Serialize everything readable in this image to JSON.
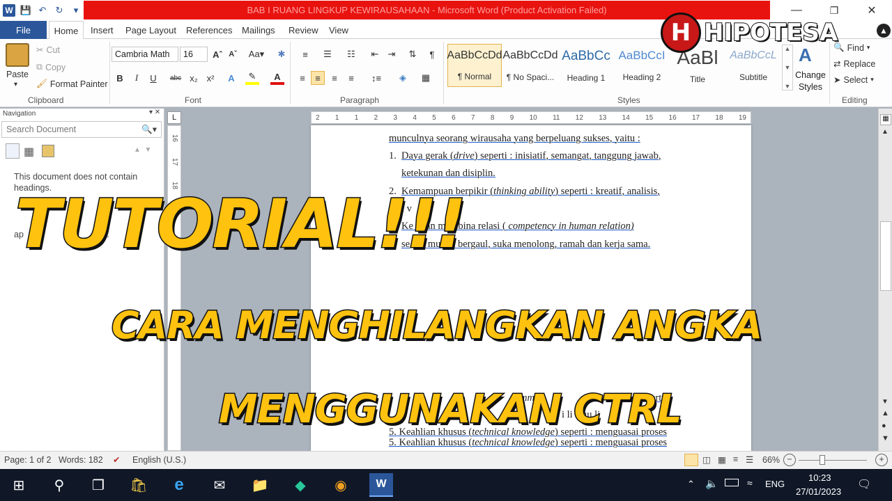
{
  "window": {
    "title": "BAB I RUANG LINGKUP KEWIRAUSAHAAN  -  Microsoft Word (Product Activation Failed)",
    "controls": [
      "—",
      "❐",
      "✕"
    ]
  },
  "tabs": [
    "File",
    "Home",
    "Insert",
    "Page Layout",
    "References",
    "Mailings",
    "Review",
    "View"
  ],
  "clipboard": {
    "paste": "Paste",
    "cut": "Cut",
    "copy": "Copy",
    "format_painter": "Format Painter",
    "group": "Clipboard"
  },
  "font": {
    "name": "Cambria Math",
    "size": "16",
    "group": "Font"
  },
  "paragraph": {
    "group": "Paragraph"
  },
  "styles": {
    "group": "Styles",
    "items": [
      {
        "preview": "AaBbCcDd",
        "name": "¶ Normal"
      },
      {
        "preview": "AaBbCcDd",
        "name": "¶ No Spaci..."
      },
      {
        "preview": "AaBbCc",
        "name": "Heading 1"
      },
      {
        "preview": "AaBbCcI",
        "name": "Heading 2"
      },
      {
        "preview": "AaBl",
        "name": "Title"
      },
      {
        "preview": "AaBbCcL",
        "name": "Subtitle"
      }
    ],
    "change": "Change Styles"
  },
  "editing": {
    "find": "Find",
    "replace": "Replace",
    "select": "Select",
    "group": "Editing"
  },
  "navigation": {
    "title": "Navigation",
    "search_placeholder": "Search Document",
    "no_headings": "This document does not contain headings.",
    "hint_fragment": "ap",
    "hint_end": "es."
  },
  "ruler": [
    "2",
    "1",
    "1",
    "2",
    "3",
    "4",
    "5",
    "6",
    "7",
    "8",
    "9",
    "10",
    "11",
    "12",
    "13",
    "14",
    "15",
    "16",
    "17",
    "18",
    "19"
  ],
  "vruler": [
    "16",
    "17",
    "18",
    "19"
  ],
  "document": {
    "line0": "munculnya seorang wirausaha yang berpeluang sukses, yaitu :",
    "item1_num": "1.",
    "item1_a": "Daya gerak (",
    "item1_b": "drive",
    "item1_c": ") seperti : inisiatif, semangat, tanggung jawab,",
    "item1_line2": "ketekunan dan disiplin.",
    "item2_num": "2.",
    "item2_a": "Kemampuan berpikir (",
    "item2_b": "thinking ability",
    "item2_c": ") seperti : kreatif, analisis,",
    "item2_line2": "i  v",
    "item3_a": "Ke   puan membina relasi ( ",
    "item3_b": "competency",
    "item3_c": " in human relation)",
    "item3_line2a": "se",
    "item3_line2b": ": mudah bergaul, suka menolong, ramah dan kerja sama.",
    "item4_end": "erti :",
    "item4_mid": "mm",
    "item4_line2": "i li    atau   li",
    "item5_a": "5.  Keahlian khusus (",
    "item5_b": "technical knowledge",
    "item5_c": ") seperti : menguasai proses"
  },
  "overlay": {
    "line1": "TUTORIAL!!!",
    "line2": "CARA MENGHILANGKAN ANGKA",
    "line3": "MENGGUNAKAN CTRL",
    "logo": "HIPOTESA",
    "logo_h": "H"
  },
  "status": {
    "page": "Page: 1 of 2",
    "words": "Words: 182",
    "language": "English (U.S.)",
    "zoom": "66%"
  },
  "taskbar": {
    "lang": "ENG",
    "time": "10:23",
    "date": "27/01/2023"
  },
  "colors": {
    "accent": "#2b579a",
    "title_red": "#e8130f",
    "overlay_yellow": "#ffc20e"
  }
}
